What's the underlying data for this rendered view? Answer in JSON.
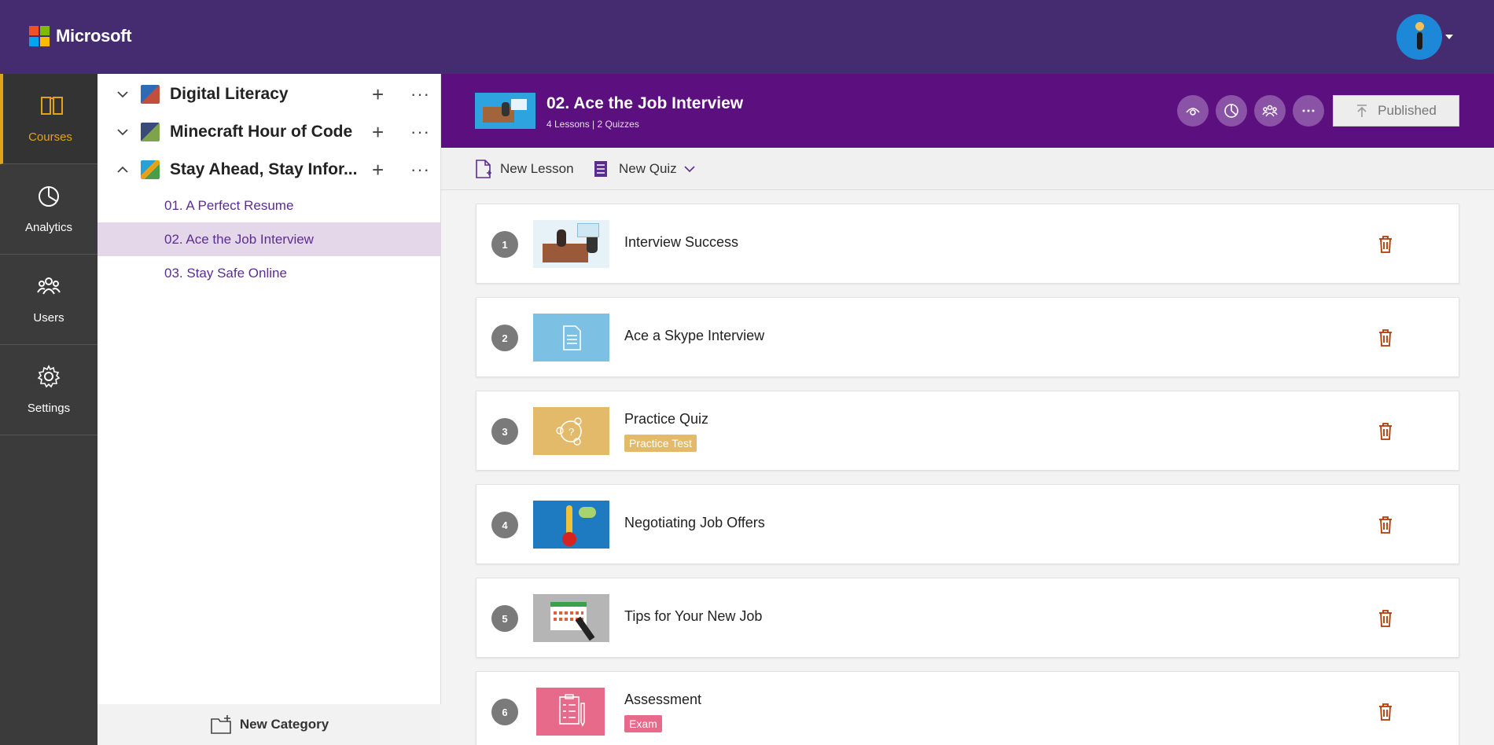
{
  "header": {
    "brand": "Microsoft",
    "logo_colors": [
      "#f25022",
      "#7fba00",
      "#00a4ef",
      "#ffb900"
    ]
  },
  "nav": {
    "items": [
      {
        "label": "Courses",
        "icon": "book-icon",
        "active": true
      },
      {
        "label": "Analytics",
        "icon": "pie-chart-icon",
        "active": false
      },
      {
        "label": "Users",
        "icon": "users-icon",
        "active": false
      },
      {
        "label": "Settings",
        "icon": "gear-icon",
        "active": false
      }
    ]
  },
  "tree": {
    "categories": [
      {
        "title": "Digital Literacy",
        "expanded": false
      },
      {
        "title": "Minecraft Hour of Code",
        "expanded": false
      },
      {
        "title": "Stay Ahead, Stay Infor...",
        "expanded": true
      }
    ],
    "lessons": [
      {
        "title": "01. A Perfect Resume",
        "selected": false
      },
      {
        "title": "02. Ace the Job Interview",
        "selected": true
      },
      {
        "title": "03. Stay Safe Online",
        "selected": false
      }
    ],
    "new_category_label": "New Category"
  },
  "course": {
    "title": "02. Ace the Job Interview",
    "subtitle": "4 Lessons | 2 Quizzes",
    "published_label": "Published"
  },
  "toolbar": {
    "new_lesson_label": "New Lesson",
    "new_quiz_label": "New Quiz"
  },
  "items": [
    {
      "number": "1",
      "title": "Interview Success",
      "tag": null,
      "thumb": "interview-illustration"
    },
    {
      "number": "2",
      "title": "Ace a Skype Interview",
      "tag": null,
      "thumb": "document-icon"
    },
    {
      "number": "3",
      "title": "Practice Quiz",
      "tag": "Practice Test",
      "tag_color": "#e3b96a",
      "thumb": "quiz-icon"
    },
    {
      "number": "4",
      "title": "Negotiating Job Offers",
      "tag": null,
      "thumb": "thermometer-illustration"
    },
    {
      "number": "5",
      "title": "Tips for Your New Job",
      "tag": null,
      "thumb": "calendar-illustration"
    },
    {
      "number": "6",
      "title": "Assessment",
      "tag": "Exam",
      "tag_color": "#e86a8a",
      "thumb": "clipboard-icon"
    }
  ],
  "colors": {
    "topbar": "#452b6f",
    "course_header": "#5c0f7f",
    "accent": "#e3a21a",
    "rail": "#3b3b3b",
    "trash": "#b33a00"
  }
}
